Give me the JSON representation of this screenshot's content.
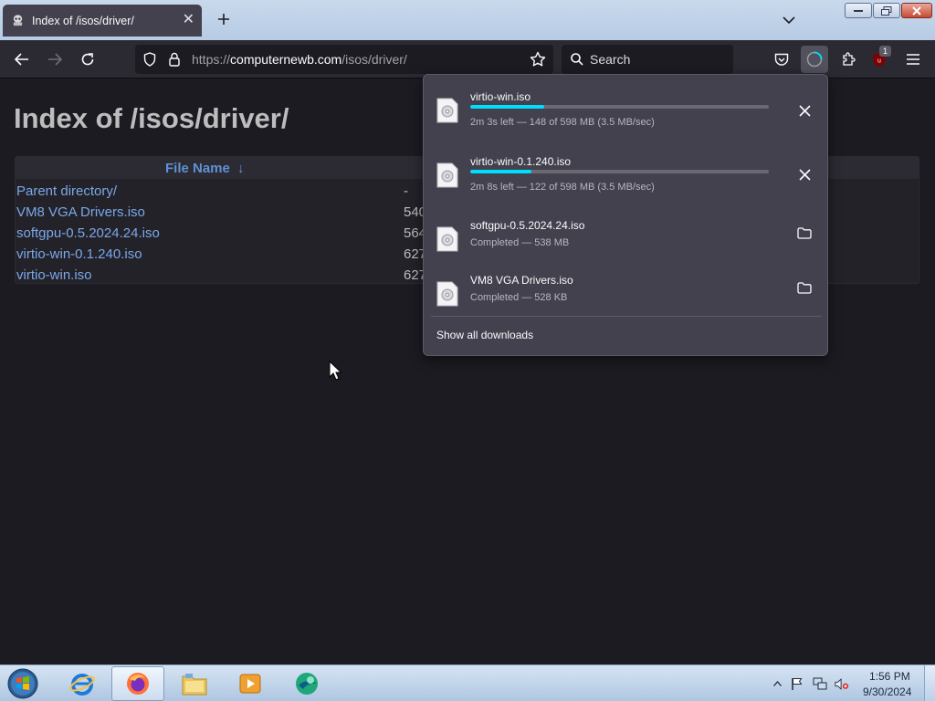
{
  "tab": {
    "title": "Index of /isos/driver/",
    "close_glyph": "✕"
  },
  "urlbar": {
    "prefix": "https://",
    "domain": "computernewb.com",
    "path": "/isos/driver/"
  },
  "search": {
    "placeholder": "Search"
  },
  "extension_badge": "1",
  "page": {
    "title": "Index of /isos/driver/",
    "column_name": "File Name",
    "sort_arrow": "↓",
    "rows": [
      {
        "name": "Parent directory/",
        "size": "-"
      },
      {
        "name": "VM8 VGA Drivers.iso",
        "size": "540"
      },
      {
        "name": "softgpu-0.5.2024.24.iso",
        "size": "564"
      },
      {
        "name": "virtio-win-0.1.240.iso",
        "size": "627"
      },
      {
        "name": "virtio-win.iso",
        "size": "627"
      }
    ]
  },
  "downloads": {
    "items": [
      {
        "name": "virtio-win.iso",
        "status": "2m 3s left — 148 of 598 MB (3.5 MB/sec)",
        "progress": 0.247,
        "in_progress": true,
        "action_icon": "close-icon"
      },
      {
        "name": "virtio-win-0.1.240.iso",
        "status": "2m 8s left — 122 of 598 MB (3.5 MB/sec)",
        "progress": 0.204,
        "in_progress": true,
        "action_icon": "close-icon"
      },
      {
        "name": "softgpu-0.5.2024.24.iso",
        "status": "Completed — 538 MB",
        "in_progress": false,
        "action_icon": "folder-icon"
      },
      {
        "name": "VM8 VGA Drivers.iso",
        "status": "Completed — 528 KB",
        "in_progress": false,
        "action_icon": "folder-icon"
      }
    ],
    "show_all": "Show all downloads"
  },
  "taskbar": {
    "clock_time": "1:56 PM",
    "clock_date": "9/30/2024"
  },
  "colors": {
    "progress": "#00ddff",
    "link": "#7aa8e8",
    "panel": "#42414d",
    "page_bg": "#1c1b22"
  }
}
